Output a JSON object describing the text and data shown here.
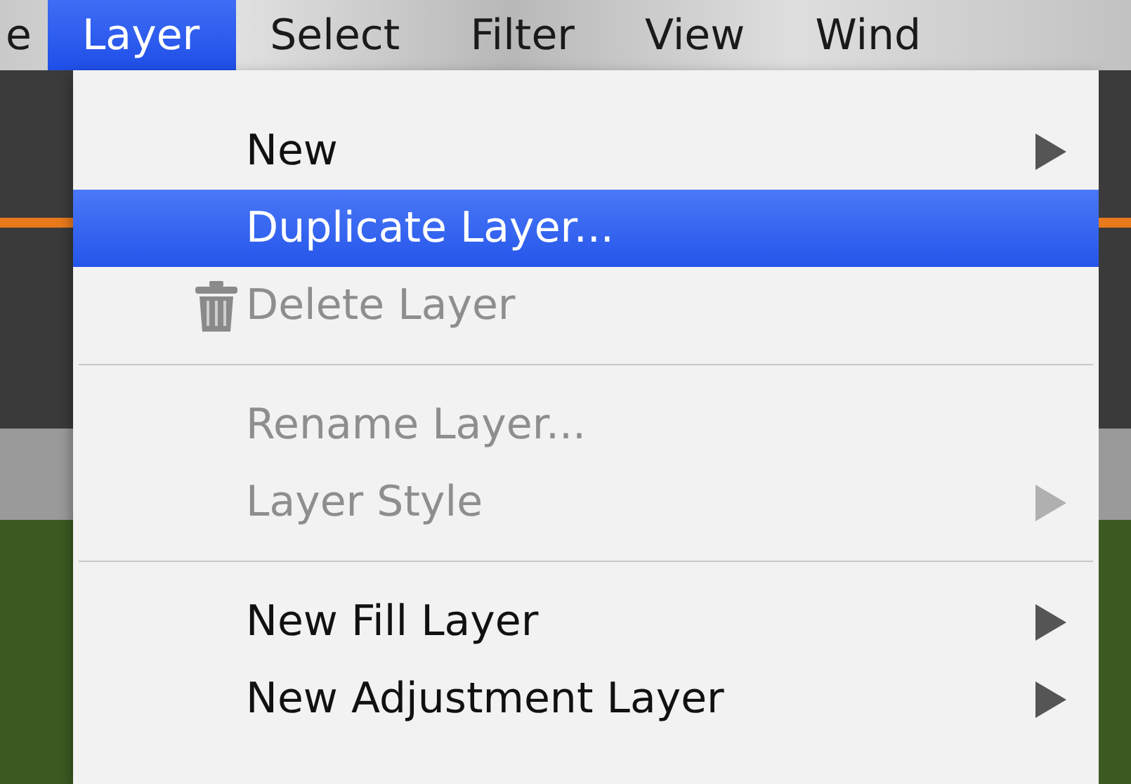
{
  "menu_bar": [
    {
      "label": "e",
      "selected": false
    },
    {
      "label": "Layer",
      "selected": true
    },
    {
      "label": "Select",
      "selected": false
    },
    {
      "label": "Filter",
      "selected": false
    },
    {
      "label": "View",
      "selected": false
    },
    {
      "label": "Wind",
      "selected": false
    }
  ],
  "menu": {
    "items": [
      {
        "kind": "item",
        "label": "New",
        "selected": false,
        "disabled": false,
        "submenu": true
      },
      {
        "kind": "item",
        "label": "Duplicate Layer...",
        "selected": true,
        "disabled": false,
        "submenu": false
      },
      {
        "kind": "trash",
        "label": "Delete Layer",
        "selected": false,
        "disabled": true,
        "submenu": false
      },
      {
        "kind": "separator"
      },
      {
        "kind": "item",
        "label": "Rename Layer...",
        "selected": false,
        "disabled": true,
        "submenu": false
      },
      {
        "kind": "item",
        "label": "Layer Style",
        "selected": false,
        "disabled": true,
        "submenu": true
      },
      {
        "kind": "separator"
      },
      {
        "kind": "item",
        "label": "New Fill Layer",
        "selected": false,
        "disabled": false,
        "submenu": true
      },
      {
        "kind": "item",
        "label": "New Adjustment Layer",
        "selected": false,
        "disabled": false,
        "submenu": true
      }
    ]
  }
}
